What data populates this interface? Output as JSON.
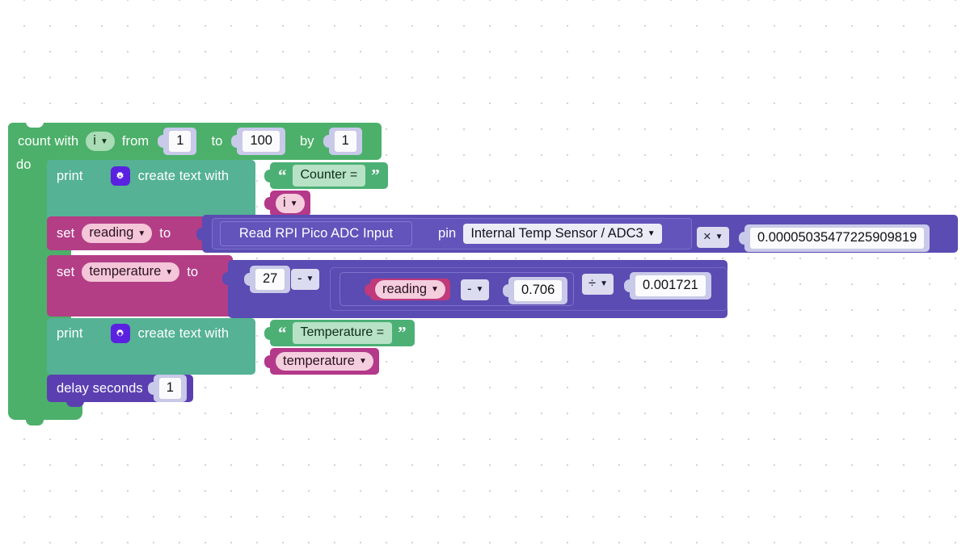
{
  "workspace": {
    "background": "#ffffff",
    "grid_dot_color": "#d2d2d6"
  },
  "colors": {
    "loop": "#4cb06a",
    "print": "#55b294",
    "string": "#4cb075",
    "variable_set": "#b33e86",
    "variable_get": "#b4398a",
    "math": "#5a4cb2",
    "adc": "#5a4cb2",
    "delay": "#5b3fb0",
    "number_block": "#c9c9ea",
    "gear_button": "#5b21e0"
  },
  "program": {
    "loop": {
      "label_count_with": "count with",
      "variable": "i",
      "label_from": "from",
      "from_value": "1",
      "label_to": "to",
      "to_value": "100",
      "label_by": "by",
      "by_value": "1",
      "label_do": "do"
    },
    "statements": [
      {
        "type": "print",
        "label": "print",
        "mutator_icon": "gear-icon",
        "text_join_label": "create text with",
        "inputs": [
          {
            "type": "string",
            "value": "Counter =",
            "open_quote": "“",
            "close_quote": "”"
          },
          {
            "type": "variable",
            "value": "i"
          }
        ]
      },
      {
        "type": "set_variable",
        "label_set": "set",
        "variable": "reading",
        "label_to": "to",
        "value": {
          "type": "math_multiply",
          "left": {
            "type": "adc_read",
            "label": "Read RPI Pico ADC Input",
            "pin_label": "pin",
            "pin_value": "Internal Temp Sensor / ADC3"
          },
          "operator": "×",
          "right": "0.00005035477225909819"
        }
      },
      {
        "type": "set_variable",
        "label_set": "set",
        "variable": "temperature",
        "label_to": "to",
        "value": {
          "type": "math_subtract",
          "left": "27",
          "operator": "-",
          "right": {
            "type": "math_divide",
            "left": {
              "type": "math_subtract",
              "left": {
                "type": "variable",
                "value": "reading"
              },
              "operator": "-",
              "right": "0.706"
            },
            "operator": "÷",
            "right": "0.001721"
          }
        }
      },
      {
        "type": "print",
        "label": "print",
        "mutator_icon": "gear-icon",
        "text_join_label": "create text with",
        "inputs": [
          {
            "type": "string",
            "value": "Temperature =",
            "open_quote": "“",
            "close_quote": "”"
          },
          {
            "type": "variable",
            "value": "temperature"
          }
        ]
      },
      {
        "type": "delay",
        "label": "delay seconds",
        "value": "1"
      }
    ]
  },
  "caret": "▼"
}
